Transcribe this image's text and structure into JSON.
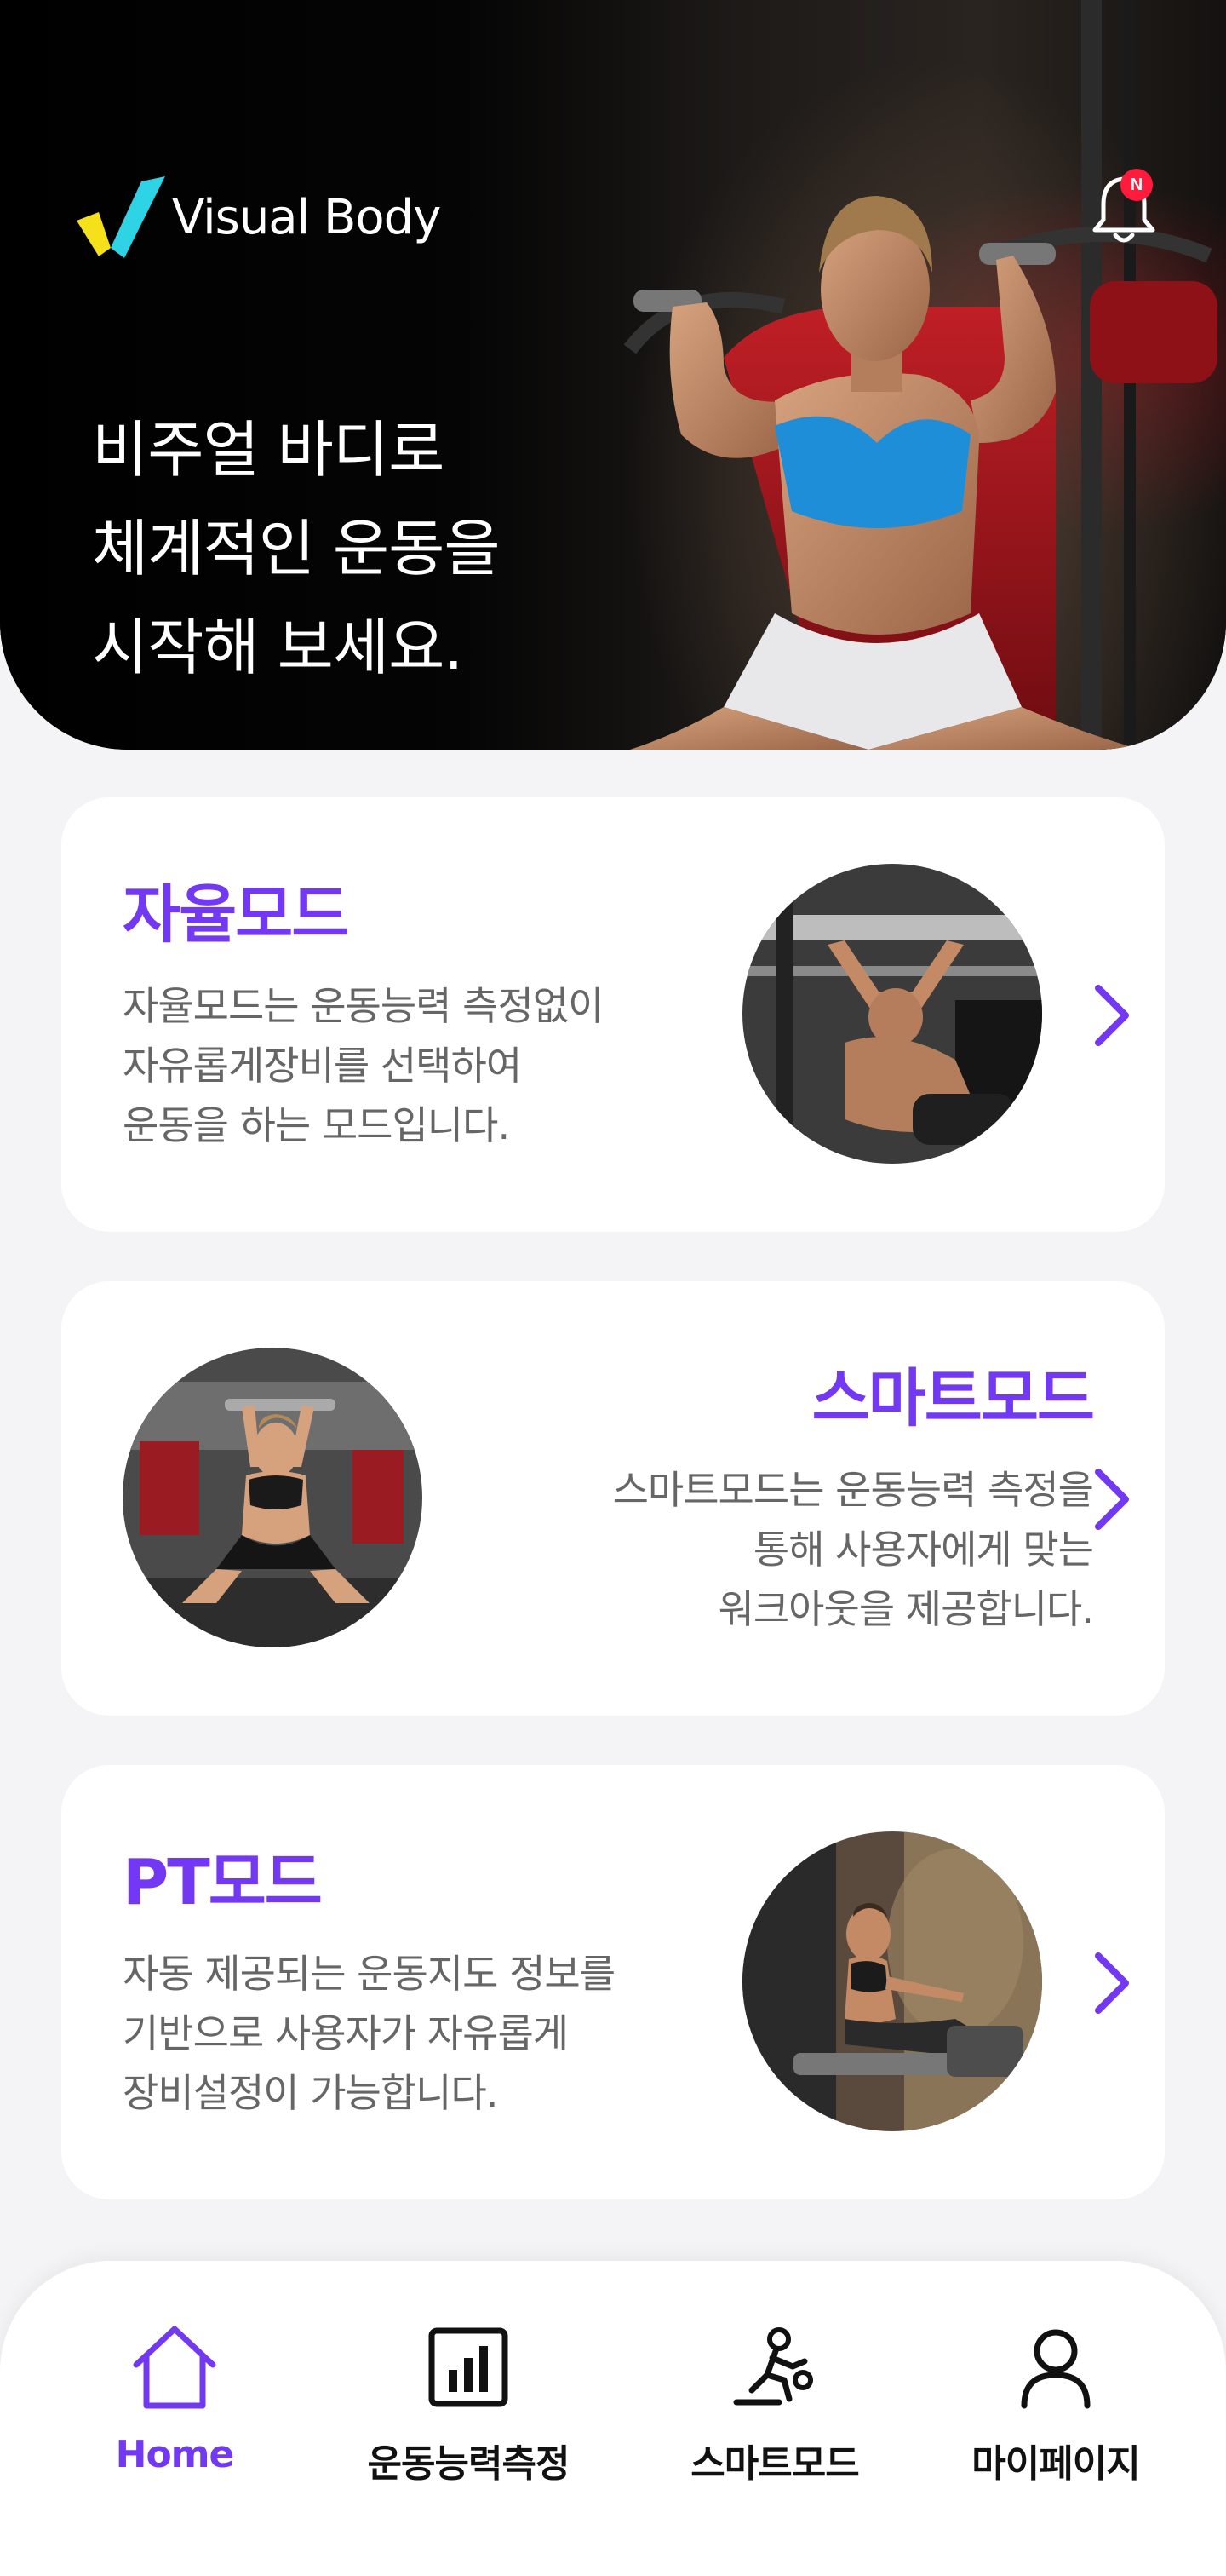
{
  "brand": {
    "name": "Visual Body"
  },
  "header": {
    "notification_badge": "N"
  },
  "hero": {
    "title": "비주얼 바디로\n체계적인 운동을\n시작해 보세요."
  },
  "modes": [
    {
      "title": "자율모드",
      "description": "자율모드는 운동능력 측정없이\n자유롭게장비를 선택하여\n운동을 하는 모드입니다.",
      "image": "lat-pulldown-man-photo"
    },
    {
      "title": "스마트모드",
      "description": "스마트모드는 운동능력 측정을\n통해 사용자에게 맞는\n워크아웃을 제공합니다.",
      "image": "shoulder-press-woman-photo"
    },
    {
      "title": "PT모드",
      "description": "자동 제공되는 운동지도 정보를\n기반으로 사용자가 자유롭게\n장비설정이 가능합니다.",
      "image": "rowing-woman-photo"
    }
  ],
  "bottom_nav": [
    {
      "label": "Home",
      "icon": "home-icon",
      "active": true
    },
    {
      "label": "운동능력측정",
      "icon": "chart-icon",
      "active": false
    },
    {
      "label": "스마트모드",
      "icon": "exercise-icon",
      "active": false
    },
    {
      "label": "마이페이지",
      "icon": "person-icon",
      "active": false
    }
  ],
  "colors": {
    "accent": "#7238f2",
    "hero_background": "#000000",
    "badge": "#ff1b3c",
    "page_background": "#f4f4f6",
    "logo_yellow": "#f5e11a",
    "logo_cyan": "#2ed4e6"
  }
}
